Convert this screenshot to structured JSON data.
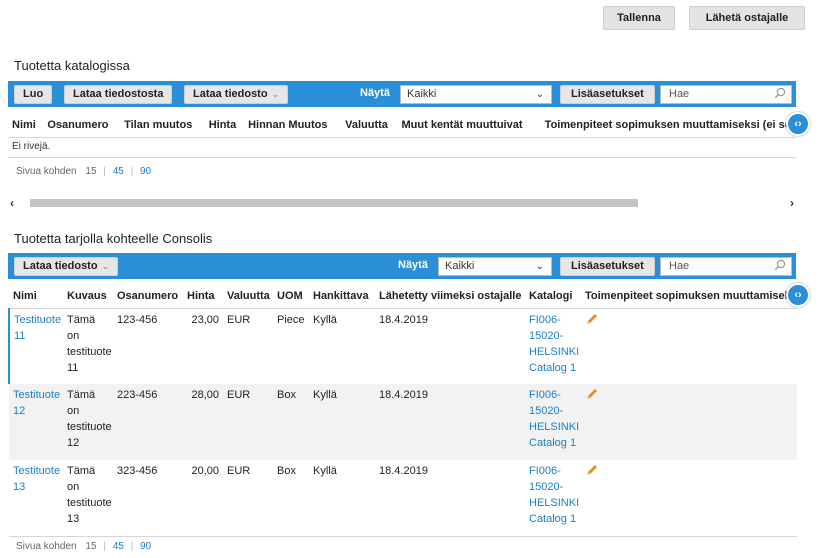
{
  "top": {
    "save_label": "Tallenna",
    "send_label": "Lähetä ostajalle"
  },
  "catalog_section": {
    "title": "Tuotetta katalogissa",
    "toolbar": {
      "create_label": "Luo",
      "upload_label": "Lataa tiedostosta",
      "download_label": "Lataa tiedosto",
      "show_label": "Näytä",
      "show_value": "Kaikki",
      "advanced_label": "Lisäasetukset",
      "search_placeholder": "Hae"
    },
    "columns": [
      "Nimi",
      "Osanumero",
      "Tilan muutos",
      "Hinta",
      "Hinnan Muutos",
      "Valuutta",
      "Muut kentät muuttuivat",
      "Toimenpiteet sopimuksen muuttamiseksi (ei sopimuksen"
    ],
    "empty_text": "Ei rivejä.",
    "pager": {
      "label": "Sivua kohden",
      "opt1": "15",
      "opt2": "45",
      "opt3": "90"
    }
  },
  "offer_section": {
    "title": "Tuotetta tarjolla kohteelle Consolis",
    "toolbar": {
      "download_label": "Lataa tiedosto",
      "show_label": "Näytä",
      "show_value": "Kaikki",
      "advanced_label": "Lisäasetukset",
      "search_placeholder": "Hae"
    },
    "columns": [
      "Nimi",
      "Kuvaus",
      "Osanumero",
      "Hinta",
      "Valuutta",
      "UOM",
      "Hankittava",
      "Lähetetty viimeksi ostajalle",
      "Katalogi",
      "Toimenpiteet sopimuksen muuttamiseksi"
    ],
    "rows": [
      {
        "name_a": "Testituote",
        "name_b": "11",
        "desc_a": "Tämä on",
        "desc_b": "testituote",
        "desc_c": "11",
        "part": "123-456",
        "price": "23,00",
        "currency": "EUR",
        "uom": "Piece",
        "procurable": "Kyllä",
        "sent": "18.4.2019",
        "cat_a": "FI006-",
        "cat_b": "15020-",
        "cat_c": "HELSINKI",
        "cat_d": "Catalog 1"
      },
      {
        "name_a": "Testituote",
        "name_b": "12",
        "desc_a": "Tämä on",
        "desc_b": "testituote",
        "desc_c": "12",
        "part": "223-456",
        "price": "28,00",
        "currency": "EUR",
        "uom": "Box",
        "procurable": "Kyllä",
        "sent": "18.4.2019",
        "cat_a": "FI006-",
        "cat_b": "15020-",
        "cat_c": "HELSINKI",
        "cat_d": "Catalog 1"
      },
      {
        "name_a": "Testituote",
        "name_b": "13",
        "desc_a": "Tämä on",
        "desc_b": "testituote",
        "desc_c": "13",
        "part": "323-456",
        "price": "20,00",
        "currency": "EUR",
        "uom": "Box",
        "procurable": "Kyllä",
        "sent": "18.4.2019",
        "cat_a": "FI006-",
        "cat_b": "15020-",
        "cat_c": "HELSINKI",
        "cat_d": "Catalog 1"
      }
    ],
    "pager": {
      "label": "Sivua kohden",
      "opt1": "15",
      "opt2": "45",
      "opt3": "90"
    }
  },
  "icons": {
    "edit": "pencil-icon",
    "search": "magnifier-icon",
    "scroll": "code-arrows-icon"
  },
  "colors": {
    "accent": "#2a8fd6",
    "link": "#1a7fc9",
    "pencil": "#e8891c"
  }
}
